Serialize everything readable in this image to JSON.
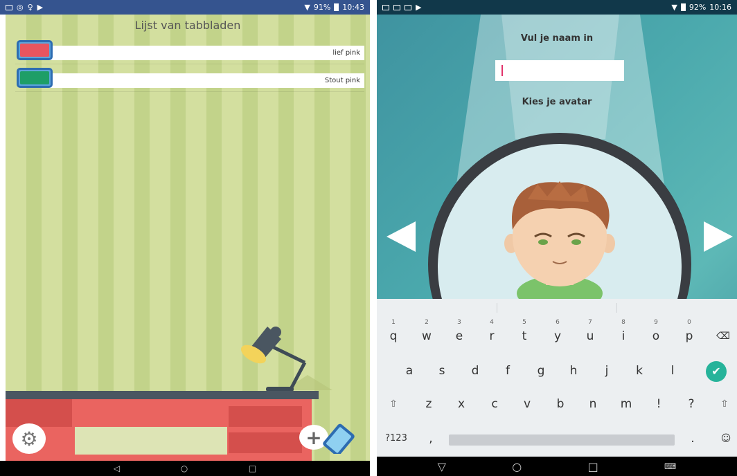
{
  "left": {
    "status": {
      "battery": "91%",
      "time": "10:43"
    },
    "title": "Lijst van tabbladen",
    "tabs": [
      {
        "label": "lief pink",
        "color": "#e8555f"
      },
      {
        "label": "Stout pink",
        "color": "#1e9e67"
      }
    ],
    "icons": {
      "settings": "gear-icon",
      "add": "plus-icon",
      "tablet": "tablet-icon"
    },
    "nav": {
      "back": "◁",
      "home": "○",
      "recents": "□"
    }
  },
  "right": {
    "status": {
      "battery": "92%",
      "time": "10:16"
    },
    "name_prompt": "Vul je naam in",
    "name_value": "",
    "avatar_prompt": "Kies je avatar",
    "keyboard": {
      "row1": [
        "q",
        "w",
        "e",
        "r",
        "t",
        "y",
        "u",
        "i",
        "o",
        "p"
      ],
      "row1_numbers": [
        "1",
        "2",
        "3",
        "4",
        "5",
        "6",
        "7",
        "8",
        "9",
        "0"
      ],
      "row2": [
        "a",
        "s",
        "d",
        "f",
        "g",
        "h",
        "j",
        "k",
        "l"
      ],
      "row3": [
        "z",
        "x",
        "c",
        "v",
        "b",
        "n",
        "m",
        "!",
        "?"
      ],
      "symbols_key": "?123",
      "comma": ",",
      "period": "."
    },
    "nav": {
      "back": "▽",
      "home": "○",
      "recents": "□"
    }
  }
}
